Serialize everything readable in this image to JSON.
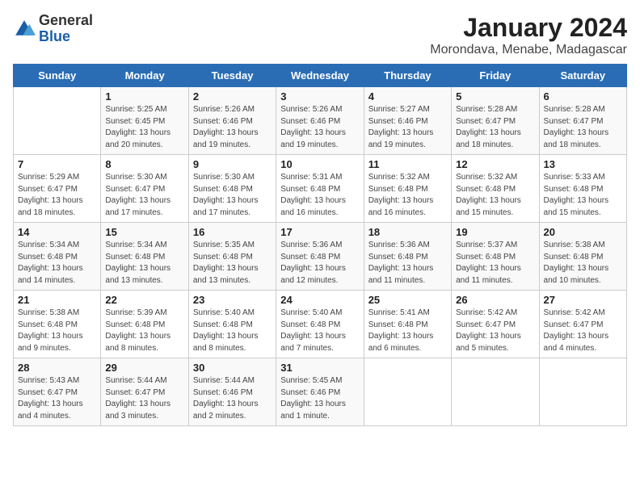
{
  "header": {
    "logo": {
      "general": "General",
      "blue": "Blue"
    },
    "title": "January 2024",
    "subtitle": "Morondava, Menabe, Madagascar"
  },
  "weekdays": [
    "Sunday",
    "Monday",
    "Tuesday",
    "Wednesday",
    "Thursday",
    "Friday",
    "Saturday"
  ],
  "weeks": [
    [
      null,
      {
        "day": "1",
        "sunrise": "5:25 AM",
        "sunset": "6:45 PM",
        "daylight": "13 hours and 20 minutes."
      },
      {
        "day": "2",
        "sunrise": "5:26 AM",
        "sunset": "6:46 PM",
        "daylight": "13 hours and 19 minutes."
      },
      {
        "day": "3",
        "sunrise": "5:26 AM",
        "sunset": "6:46 PM",
        "daylight": "13 hours and 19 minutes."
      },
      {
        "day": "4",
        "sunrise": "5:27 AM",
        "sunset": "6:46 PM",
        "daylight": "13 hours and 19 minutes."
      },
      {
        "day": "5",
        "sunrise": "5:28 AM",
        "sunset": "6:47 PM",
        "daylight": "13 hours and 18 minutes."
      },
      {
        "day": "6",
        "sunrise": "5:28 AM",
        "sunset": "6:47 PM",
        "daylight": "13 hours and 18 minutes."
      }
    ],
    [
      {
        "day": "7",
        "sunrise": "5:29 AM",
        "sunset": "6:47 PM",
        "daylight": "13 hours and 18 minutes."
      },
      {
        "day": "8",
        "sunrise": "5:30 AM",
        "sunset": "6:47 PM",
        "daylight": "13 hours and 17 minutes."
      },
      {
        "day": "9",
        "sunrise": "5:30 AM",
        "sunset": "6:48 PM",
        "daylight": "13 hours and 17 minutes."
      },
      {
        "day": "10",
        "sunrise": "5:31 AM",
        "sunset": "6:48 PM",
        "daylight": "13 hours and 16 minutes."
      },
      {
        "day": "11",
        "sunrise": "5:32 AM",
        "sunset": "6:48 PM",
        "daylight": "13 hours and 16 minutes."
      },
      {
        "day": "12",
        "sunrise": "5:32 AM",
        "sunset": "6:48 PM",
        "daylight": "13 hours and 15 minutes."
      },
      {
        "day": "13",
        "sunrise": "5:33 AM",
        "sunset": "6:48 PM",
        "daylight": "13 hours and 15 minutes."
      }
    ],
    [
      {
        "day": "14",
        "sunrise": "5:34 AM",
        "sunset": "6:48 PM",
        "daylight": "13 hours and 14 minutes."
      },
      {
        "day": "15",
        "sunrise": "5:34 AM",
        "sunset": "6:48 PM",
        "daylight": "13 hours and 13 minutes."
      },
      {
        "day": "16",
        "sunrise": "5:35 AM",
        "sunset": "6:48 PM",
        "daylight": "13 hours and 13 minutes."
      },
      {
        "day": "17",
        "sunrise": "5:36 AM",
        "sunset": "6:48 PM",
        "daylight": "13 hours and 12 minutes."
      },
      {
        "day": "18",
        "sunrise": "5:36 AM",
        "sunset": "6:48 PM",
        "daylight": "13 hours and 11 minutes."
      },
      {
        "day": "19",
        "sunrise": "5:37 AM",
        "sunset": "6:48 PM",
        "daylight": "13 hours and 11 minutes."
      },
      {
        "day": "20",
        "sunrise": "5:38 AM",
        "sunset": "6:48 PM",
        "daylight": "13 hours and 10 minutes."
      }
    ],
    [
      {
        "day": "21",
        "sunrise": "5:38 AM",
        "sunset": "6:48 PM",
        "daylight": "13 hours and 9 minutes."
      },
      {
        "day": "22",
        "sunrise": "5:39 AM",
        "sunset": "6:48 PM",
        "daylight": "13 hours and 8 minutes."
      },
      {
        "day": "23",
        "sunrise": "5:40 AM",
        "sunset": "6:48 PM",
        "daylight": "13 hours and 8 minutes."
      },
      {
        "day": "24",
        "sunrise": "5:40 AM",
        "sunset": "6:48 PM",
        "daylight": "13 hours and 7 minutes."
      },
      {
        "day": "25",
        "sunrise": "5:41 AM",
        "sunset": "6:48 PM",
        "daylight": "13 hours and 6 minutes."
      },
      {
        "day": "26",
        "sunrise": "5:42 AM",
        "sunset": "6:47 PM",
        "daylight": "13 hours and 5 minutes."
      },
      {
        "day": "27",
        "sunrise": "5:42 AM",
        "sunset": "6:47 PM",
        "daylight": "13 hours and 4 minutes."
      }
    ],
    [
      {
        "day": "28",
        "sunrise": "5:43 AM",
        "sunset": "6:47 PM",
        "daylight": "13 hours and 4 minutes."
      },
      {
        "day": "29",
        "sunrise": "5:44 AM",
        "sunset": "6:47 PM",
        "daylight": "13 hours and 3 minutes."
      },
      {
        "day": "30",
        "sunrise": "5:44 AM",
        "sunset": "6:46 PM",
        "daylight": "13 hours and 2 minutes."
      },
      {
        "day": "31",
        "sunrise": "5:45 AM",
        "sunset": "6:46 PM",
        "daylight": "13 hours and 1 minute."
      },
      null,
      null,
      null
    ]
  ]
}
